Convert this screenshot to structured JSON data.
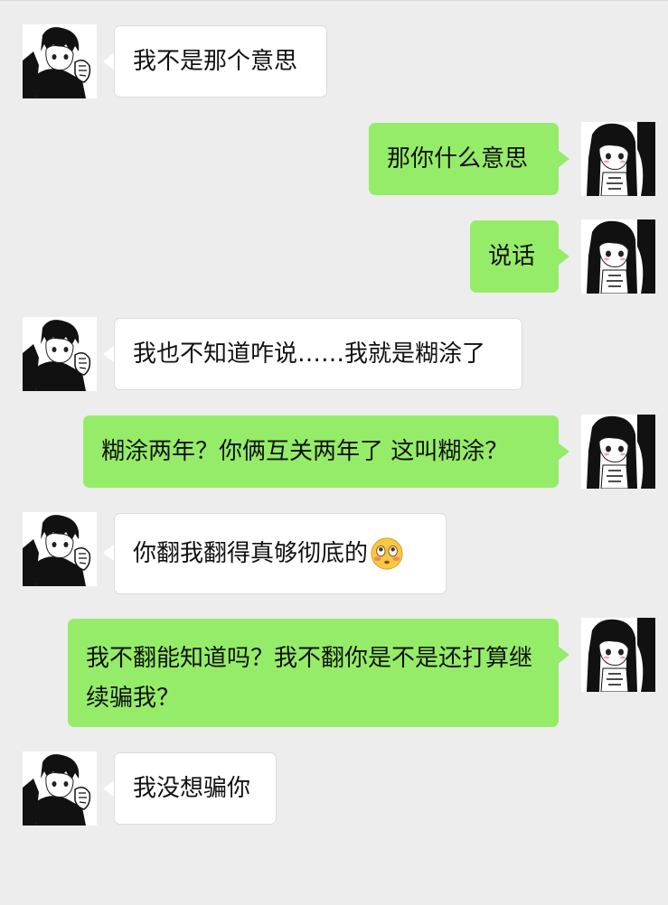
{
  "messages": [
    {
      "side": "left",
      "text": "我不是那个意思"
    },
    {
      "side": "right",
      "text": "那你什么意思"
    },
    {
      "side": "right",
      "text": "说话"
    },
    {
      "side": "left",
      "text": "我也不知道咋说……我就是糊涂了"
    },
    {
      "side": "right",
      "text": "糊涂两年？你俩互关两年了 这叫糊涂？"
    },
    {
      "side": "left",
      "text": "你翻我翻得真够彻底的",
      "emoji": "flushed-face-emoji"
    },
    {
      "side": "right",
      "text": "我不翻能知道吗？我不翻你是不是还打算继续骗我？"
    },
    {
      "side": "left",
      "text": "我没想骗你"
    }
  ],
  "colors": {
    "background": "#ededed",
    "self_bubble": "#95ec69",
    "other_bubble": "#ffffff"
  },
  "icons": {
    "left_avatar": "boy-anime-avatar",
    "right_avatar": "girl-anime-avatar"
  }
}
